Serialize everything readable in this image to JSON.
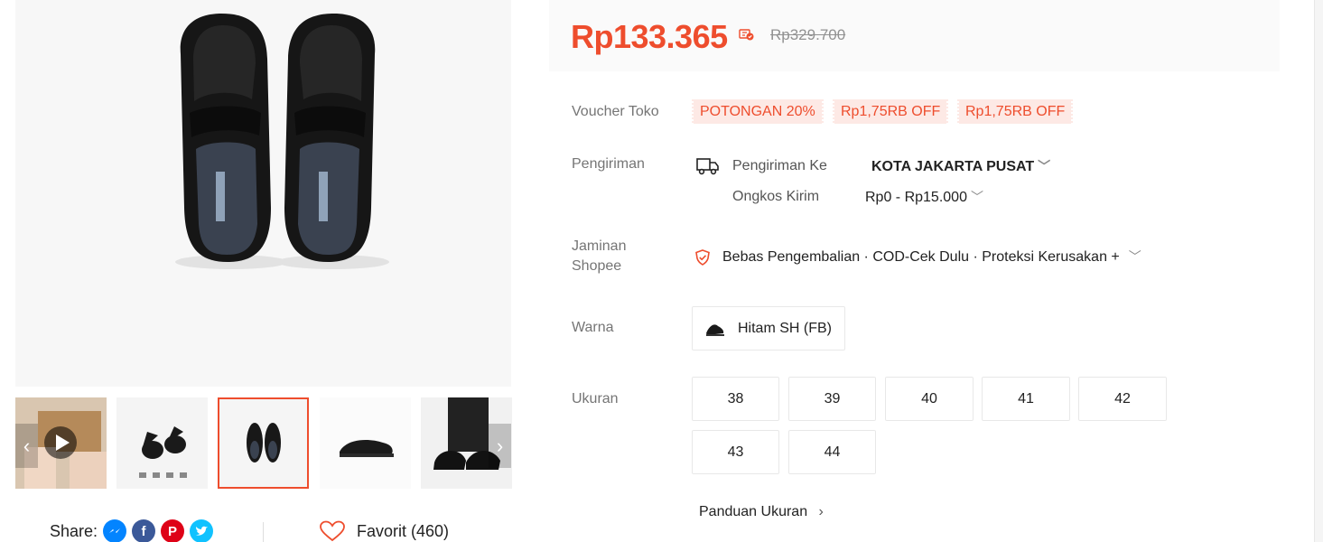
{
  "gallery": {
    "thumbnails": [
      {
        "kind": "video-unboxing"
      },
      {
        "kind": "product-catalog"
      },
      {
        "kind": "top-view",
        "active": true
      },
      {
        "kind": "side-view"
      },
      {
        "kind": "worn-view"
      }
    ]
  },
  "share": {
    "label": "Share:",
    "networks": [
      "messenger-icon",
      "facebook-icon",
      "pinterest-icon",
      "twitter-icon"
    ]
  },
  "favorite": {
    "label": "Favorit (460)"
  },
  "price": {
    "current": "Rp133.365",
    "original": "Rp329.700"
  },
  "voucher": {
    "label": "Voucher Toko",
    "tags": [
      "POTONGAN 20%",
      "Rp1,75RB OFF",
      "Rp1,75RB OFF"
    ]
  },
  "shipping": {
    "label": "Pengiriman",
    "to_label": "Pengiriman Ke",
    "to_value": "KOTA JAKARTA PUSAT",
    "cost_label": "Ongkos Kirim",
    "cost_value": "Rp0 - Rp15.000"
  },
  "guarantee": {
    "label": "Jaminan Shopee",
    "text": "Bebas Pengembalian · COD-Cek Dulu · Proteksi Kerusakan +"
  },
  "color": {
    "label": "Warna",
    "options": [
      "Hitam SH (FB)"
    ]
  },
  "size": {
    "label": "Ukuran",
    "options": [
      "38",
      "39",
      "40",
      "41",
      "42",
      "43",
      "44"
    ],
    "guide": "Panduan Ukuran"
  },
  "colors": {
    "accent": "#ee4d2d",
    "price_bg": "#fafafa",
    "voucher_bg": "#fde9e5"
  }
}
